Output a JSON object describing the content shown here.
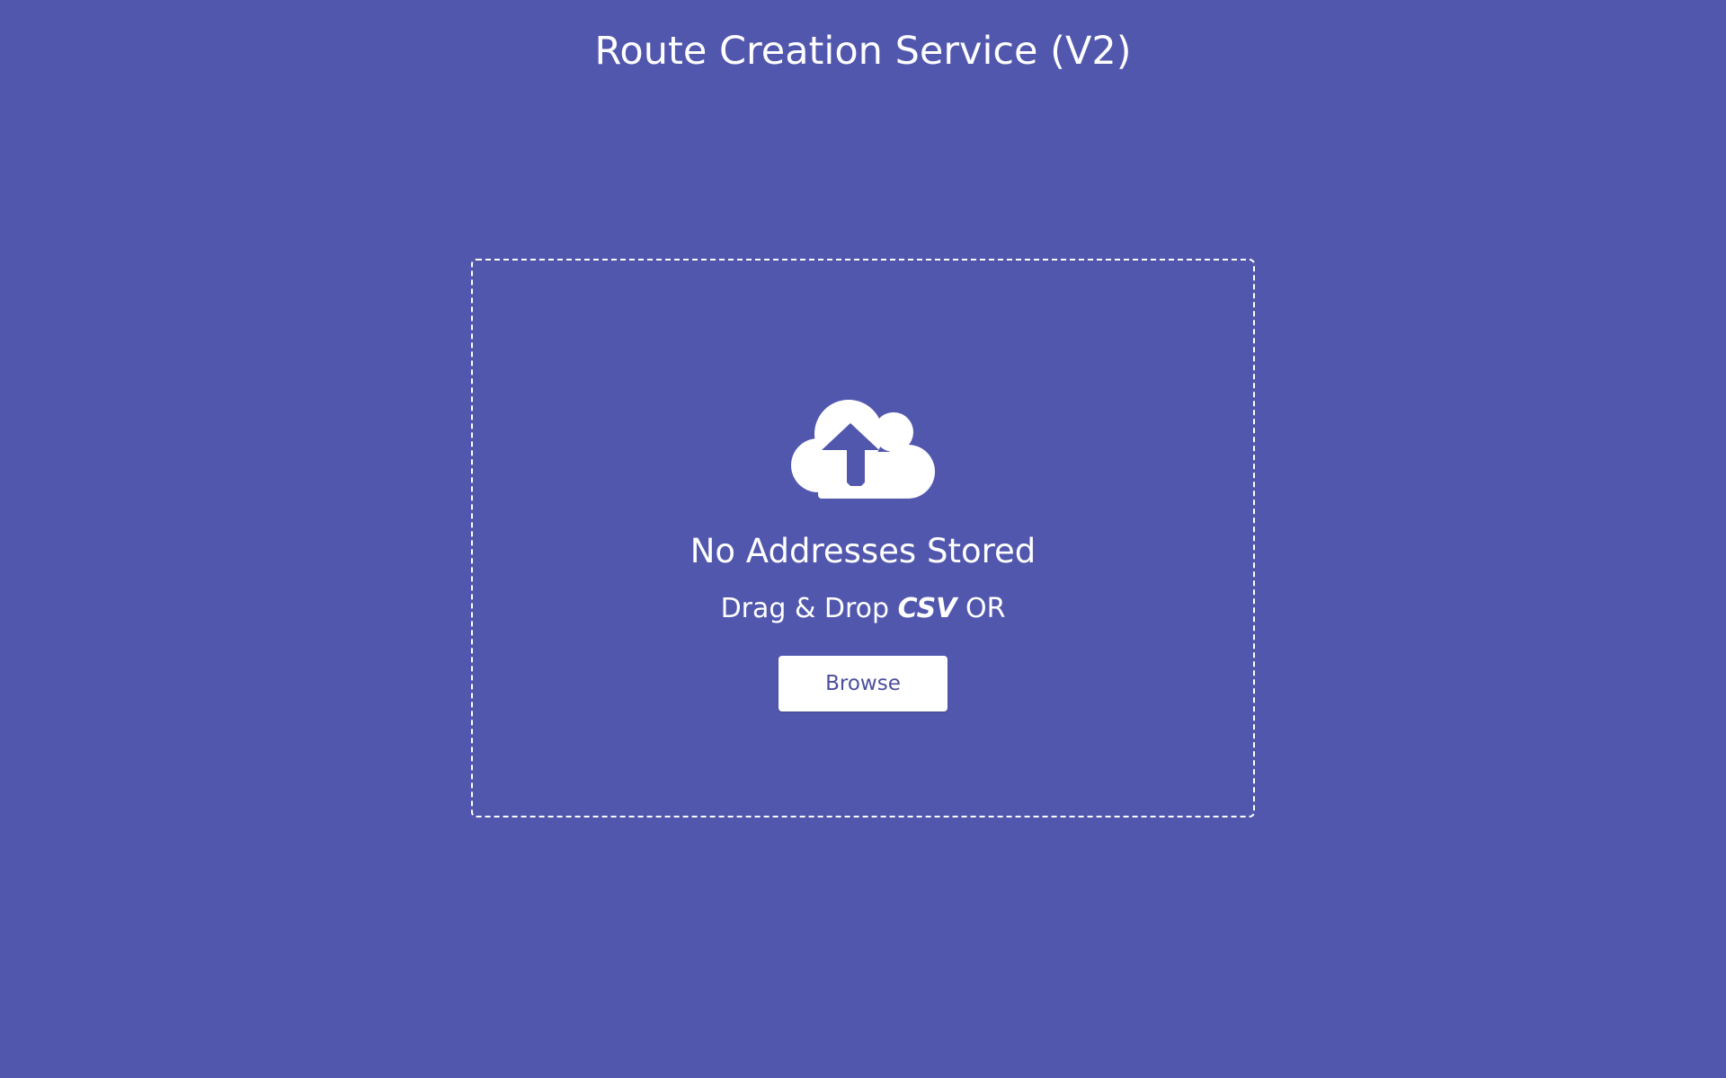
{
  "header": {
    "title": "Route Creation Service (V2)"
  },
  "drop_zone": {
    "icon": "cloud-upload-icon",
    "empty_title": "No Addresses Stored",
    "hint_prefix": "Drag & Drop",
    "hint_format": "CSV",
    "hint_suffix": "OR",
    "browse_label": "Browse"
  },
  "colors": {
    "background": "#5257ae",
    "text": "#ffffff",
    "button_text": "#4c4f9c"
  }
}
